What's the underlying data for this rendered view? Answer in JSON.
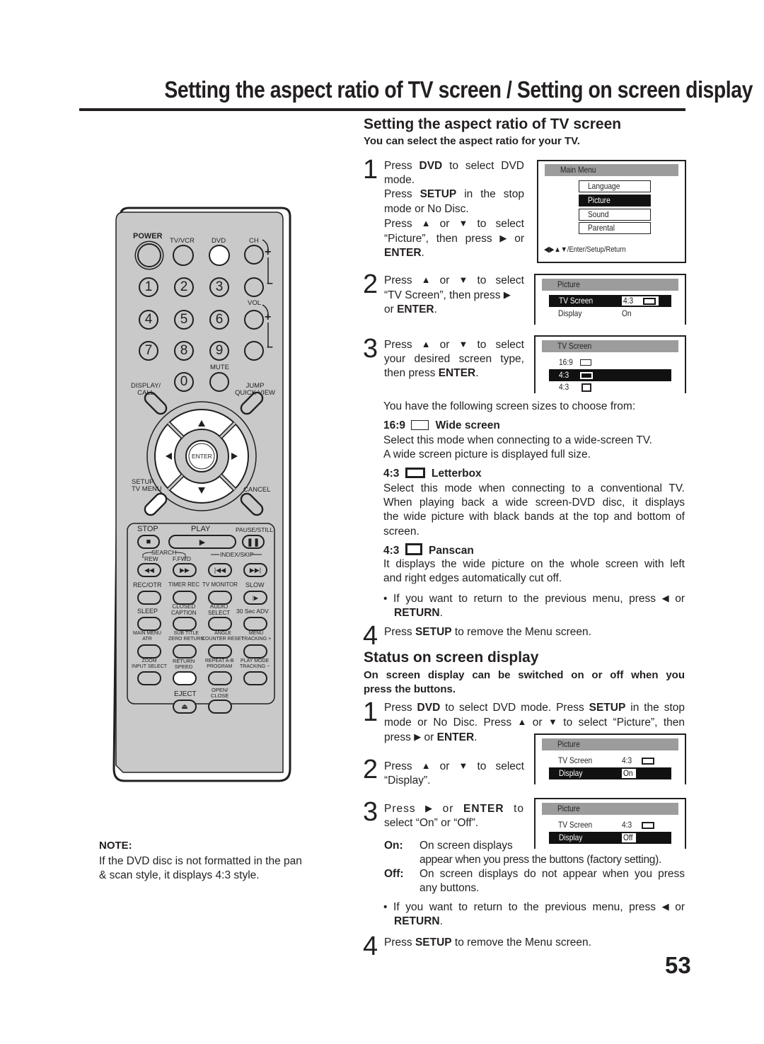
{
  "page": {
    "title": "Setting the aspect ratio of TV screen / Setting on screen display",
    "page_number": "53"
  },
  "aspect": {
    "heading": "Setting the aspect ratio of TV screen",
    "lead": "You can select the aspect ratio for your TV.",
    "step1": {
      "num": "1",
      "l1a": "Press ",
      "l1b": "DVD",
      "l1c": " to select DVD",
      "l2": "mode.",
      "l3a": "Press ",
      "l3b": "SETUP",
      "l3c": " in the stop",
      "l4": "mode or No Disc.",
      "l5a": "Press ",
      "l5b": " or ",
      "l5c": " to select",
      "l6a": "“Picture”, then press ",
      "l6b": " or",
      "l7": "ENTER",
      "l7b": "."
    },
    "step2": {
      "num": "2",
      "l1a": "Press ",
      "l1b": " or ",
      "l1c": " to select",
      "l2": "“TV Screen”, then press ",
      "l3a": "or ",
      "l3b": "ENTER",
      "l3c": "."
    },
    "step3": {
      "num": "3",
      "l1a": "Press ",
      "l1b": " or ",
      "l1c": " to select",
      "l2": "your desired screen type,",
      "l3a": "then press ",
      "l3b": "ENTER",
      "l3c": "."
    },
    "intro": "You have the following screen sizes to choose from:",
    "options": [
      {
        "ratio": "16:9",
        "name": "Wide screen",
        "icon": "wide-screen-icon",
        "desc": [
          "Select this mode when connecting to a wide-screen TV.",
          "A wide screen picture is displayed full size."
        ]
      },
      {
        "ratio": "4:3",
        "name": "Letterbox",
        "icon": "letterbox-icon",
        "desc": [
          "Select this mode when connecting to a conventional TV.",
          "When playing back a wide screen-DVD disc, it displays",
          "the wide picture with black bands at the top and bottom of",
          "screen."
        ]
      },
      {
        "ratio": "4:3",
        "name": "Panscan",
        "icon": "panscan-icon",
        "desc": [
          "It displays the wide picture on the whole screen with left",
          "and right edges automatically cut off."
        ]
      }
    ],
    "bullet": {
      "a": "If you want to return to the previous menu, press ",
      "b": " or",
      "c": "RETURN",
      "d": "."
    },
    "step4": {
      "num": "4",
      "a": "Press ",
      "b": "SETUP",
      "c": " to remove the Menu screen."
    }
  },
  "osd": {
    "main_menu": {
      "title": "Main Menu",
      "items": [
        "Language",
        "Picture",
        "Sound",
        "Parental"
      ],
      "selected": "Picture",
      "footer": "◀▶▲▼/Enter/Setup/Return"
    },
    "picture1": {
      "title": "Picture",
      "rows": [
        {
          "label": "TV Screen",
          "value": "4:3"
        },
        {
          "label": "Display",
          "value": "On"
        }
      ],
      "selected": "TV Screen"
    },
    "tv_screen": {
      "title": "TV Screen",
      "options": [
        "16:9",
        "4:3",
        "4:3"
      ],
      "selected_index": 1
    },
    "picture2": {
      "title": "Picture",
      "rows": [
        {
          "label": "TV Screen",
          "value": "4:3"
        },
        {
          "label": "Display",
          "value": "On"
        }
      ],
      "selected": "Display"
    },
    "picture3": {
      "title": "Picture",
      "rows": [
        {
          "label": "TV Screen",
          "value": "4:3"
        },
        {
          "label": "Display",
          "value": "Off"
        }
      ],
      "selected": "Display"
    }
  },
  "status": {
    "heading": "Status on screen display",
    "lead1": "On screen display can be switched on or off when you",
    "lead2": "press the buttons.",
    "step1": {
      "num": "1",
      "l1a": "Press ",
      "l1b": "DVD",
      "l1c": " to select DVD mode. Press ",
      "l1d": "SETUP",
      "l1e": " in the stop",
      "l2a": "mode or No Disc. Press ",
      "l2b": " or ",
      "l2c": " to select  “Picture”, then",
      "l3a": "press ",
      "l3b": " or ",
      "l3c": "ENTER",
      "l3d": "."
    },
    "step2": {
      "num": "2",
      "l1a": "Press ",
      "l1b": " or ",
      "l1c": " to select",
      "l2": "“Display”."
    },
    "step3": {
      "num": "3",
      "l1a": "Press ",
      "l1b": " or ",
      "l1c": "ENTER",
      "l1d": " to",
      "l2": "select  “On” or “Off”."
    },
    "on": {
      "term": "On:",
      "l1": "On screen displays",
      "l2": "appear when you press the buttons (factory setting)."
    },
    "off": {
      "term": "Off:",
      "l1": "On screen displays do not appear when you press",
      "l2": "any buttons."
    },
    "bullet": {
      "a": "If you want to return to the previous menu, press ",
      "b": " or",
      "c": "RETURN",
      "d": "."
    },
    "step4": {
      "num": "4",
      "a": "Press ",
      "b": "SETUP",
      "c": " to remove the Menu screen."
    }
  },
  "note": {
    "title": "NOTE:",
    "l1": "If the DVD disc is not formatted in the pan",
    "l2": "& scan style, it displays 4:3 style."
  },
  "remote": {
    "power": "POWER",
    "tvvcr": "TV/VCR",
    "dvd": "DVD",
    "ch": "CH",
    "vol": "VOL",
    "mute": "MUTE",
    "digits": [
      "1",
      "2",
      "3",
      "4",
      "5",
      "6",
      "7",
      "8",
      "9",
      "0"
    ],
    "display_call": [
      "DISPLAY/",
      "CALL"
    ],
    "jump": [
      "JUMP",
      "QUICK VIEW"
    ],
    "enter": "ENTER",
    "setup": [
      "SETUP",
      "TV MENU"
    ],
    "cancel": "CANCEL",
    "stop": "STOP",
    "play": "PLAY",
    "pause": "PAUSE/STILL",
    "search": "SEARCH",
    "rew": "REW",
    "ffwd": "F.FWD",
    "index_skip": "INDEX/SKIP",
    "row3": [
      "REC/OTR",
      "TIMER REC",
      "TV MONITOR",
      "SLOW"
    ],
    "row4": [
      [
        "SLEEP",
        ""
      ],
      [
        "CLOSED",
        "CAPTION"
      ],
      [
        "AUDIO",
        "SELECT"
      ],
      [
        "30 Sec ADV",
        ""
      ]
    ],
    "row5": [
      [
        "MAIN MENU",
        "ATR"
      ],
      [
        "SUB TITLE",
        "ZERO RETURN"
      ],
      [
        "ANGLE",
        "COUNTER RESET"
      ],
      [
        "MENU",
        "TRACKING +"
      ]
    ],
    "row6": [
      [
        "ZOOM",
        "INPUT SELECT"
      ],
      [
        "RETURN",
        "SPEED"
      ],
      [
        "REPEAT A-B",
        "PROGRAM"
      ],
      [
        "PLAY MODE",
        "TRACKING −"
      ]
    ],
    "eject": "EJECT",
    "open_close": [
      "OPEN/",
      "CLOSE"
    ]
  }
}
